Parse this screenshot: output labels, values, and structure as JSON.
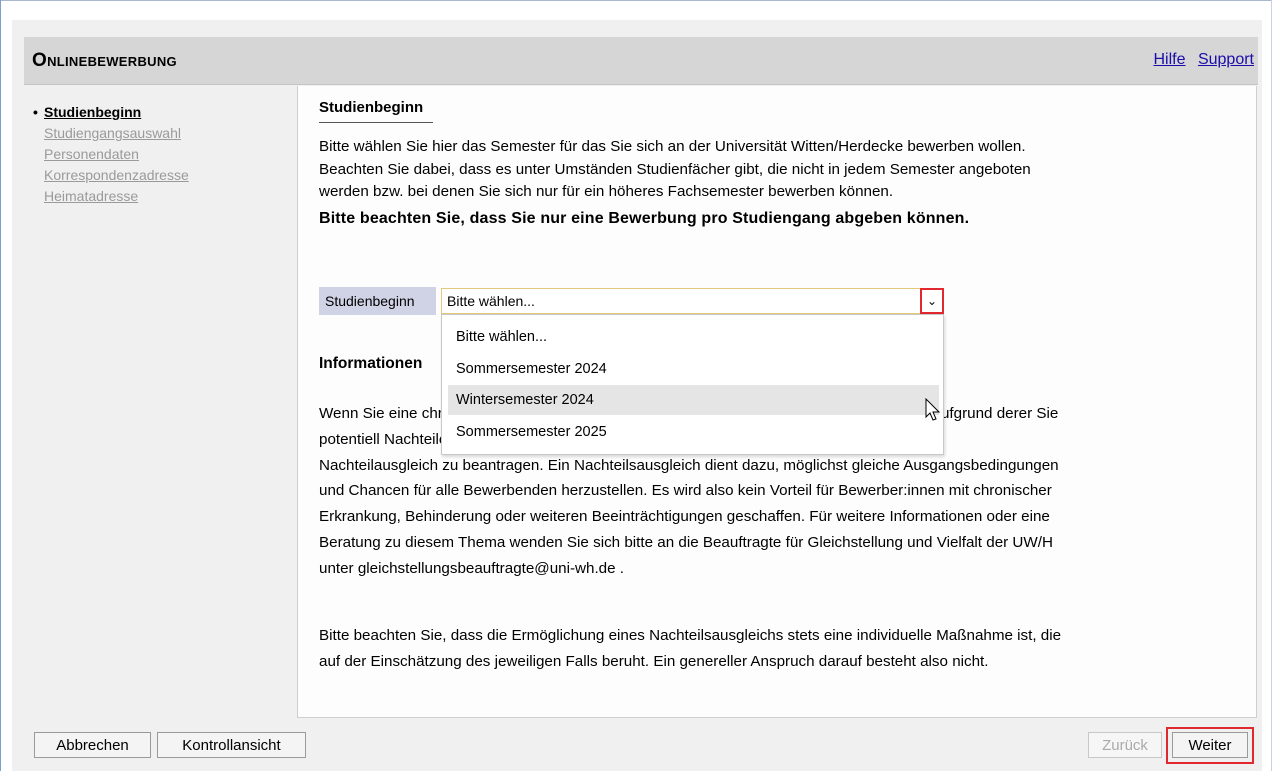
{
  "app": {
    "title": "Onlinebewerbung",
    "links": {
      "help": "Hilfe",
      "support": "Support"
    }
  },
  "sidebar": {
    "items": [
      {
        "label": "Studienbeginn",
        "active": true
      },
      {
        "label": "Studiengangsauswahl",
        "active": false
      },
      {
        "label": "Personendaten",
        "active": false
      },
      {
        "label": "Korrespondenzadresse",
        "active": false
      },
      {
        "label": "Heimatadresse",
        "active": false
      }
    ]
  },
  "main": {
    "section_title": "Studienbeginn",
    "intro_lines": [
      "Bitte wählen Sie hier das Semester für das Sie sich an der Universität Witten/Herdecke bewerben wollen.",
      "Beachten Sie dabei, dass es unter Umständen Studienfächer gibt, die nicht in jedem Semester angeboten",
      "werden bzw. bei denen Sie sich nur für ein höheres Fachsemester bewerben können."
    ],
    "intro_strong": "Bitte beachten Sie, dass Sie nur eine Bewerbung pro Studiengang abgeben können.",
    "field": {
      "label": "Studienbeginn",
      "selected": "Bitte wählen...",
      "options": [
        "Bitte wählen...",
        "Sommersemester 2024",
        "Wintersemester 2024",
        "Sommersemester 2025"
      ],
      "hovered_option": "Wintersemester 2024"
    },
    "info_heading": "Informationen",
    "para2_lines": [
      "Wenn Sie eine chronische Erkrankung, Behinderung oder weitere Beeinträchtigung haben, aufgrund derer Sie",
      "potentiell Nachteile beim Studienzugang erleiden könnten, haben Sie die Möglichkeit einen",
      "Nachteilausgleich zu beantragen. Ein Nachteilsausgleich dient dazu, möglichst gleiche Ausgangsbedingungen",
      "und Chancen für alle Bewerbenden herzustellen. Es wird also kein Vorteil für Bewerber:innen mit chronischer",
      "Erkrankung, Behinderung oder weiteren Beeinträchtigungen geschaffen. Für weitere Informationen oder eine",
      "Beratung zu diesem Thema wenden Sie sich bitte an die Beauftragte für Gleichstellung und Vielfalt der UW/H",
      "unter gleichstellungsbeauftragte@uni-wh.de ."
    ],
    "para3_lines": [
      "Bitte beachten Sie, dass die Ermöglichung eines Nachteilsausgleichs stets eine individuelle Maßnahme ist, die",
      "auf der Einschätzung des jeweiligen Falls beruht. Ein genereller Anspruch darauf besteht also nicht."
    ]
  },
  "footer": {
    "cancel": "Abbrechen",
    "control_view": "Kontrollansicht",
    "back": "Zurück",
    "next": "Weiter"
  },
  "colors": {
    "highlight": "#e0282e",
    "header_bg": "#d6d6d6",
    "label_bg": "#d0d2e6",
    "link": "#1a0dab"
  }
}
